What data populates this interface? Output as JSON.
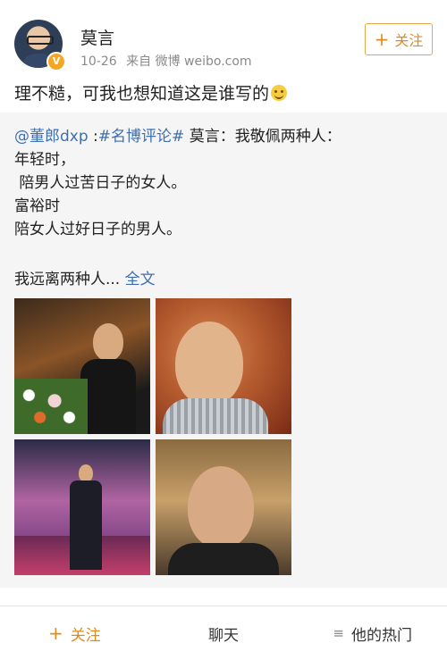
{
  "post": {
    "username": "莫言",
    "date": "10-26",
    "source": "来自 微博 weibo.com",
    "follow_label": "关注",
    "text": "理不糙，可我也想知道这是谁写的"
  },
  "repost": {
    "mention": "@董郎dxp",
    "hashtag": "#名博评论#",
    "lines": [
      " 莫言：我敬佩两种人：",
      "年轻时，",
      " 陪男人过苦日子的女人。",
      "富裕时",
      "陪女人过好日子的男人。",
      ""
    ],
    "more_text": "我远离两种人... ",
    "full_text_link": "全文",
    "photos": [
      "photo-1",
      "photo-2",
      "photo-3",
      "photo-4"
    ]
  },
  "bottom_bar": {
    "follow": "关注",
    "chat": "聊天",
    "hot": "他的热门"
  },
  "colors": {
    "accent": "#e08a1e",
    "link": "#3d6fb0",
    "repost_bg": "#f5f5f5"
  },
  "icons": {
    "plus": "plus-icon",
    "menu": "menu-icon",
    "verified": "verified-badge-icon",
    "emoji": "grin-emoji-icon"
  }
}
